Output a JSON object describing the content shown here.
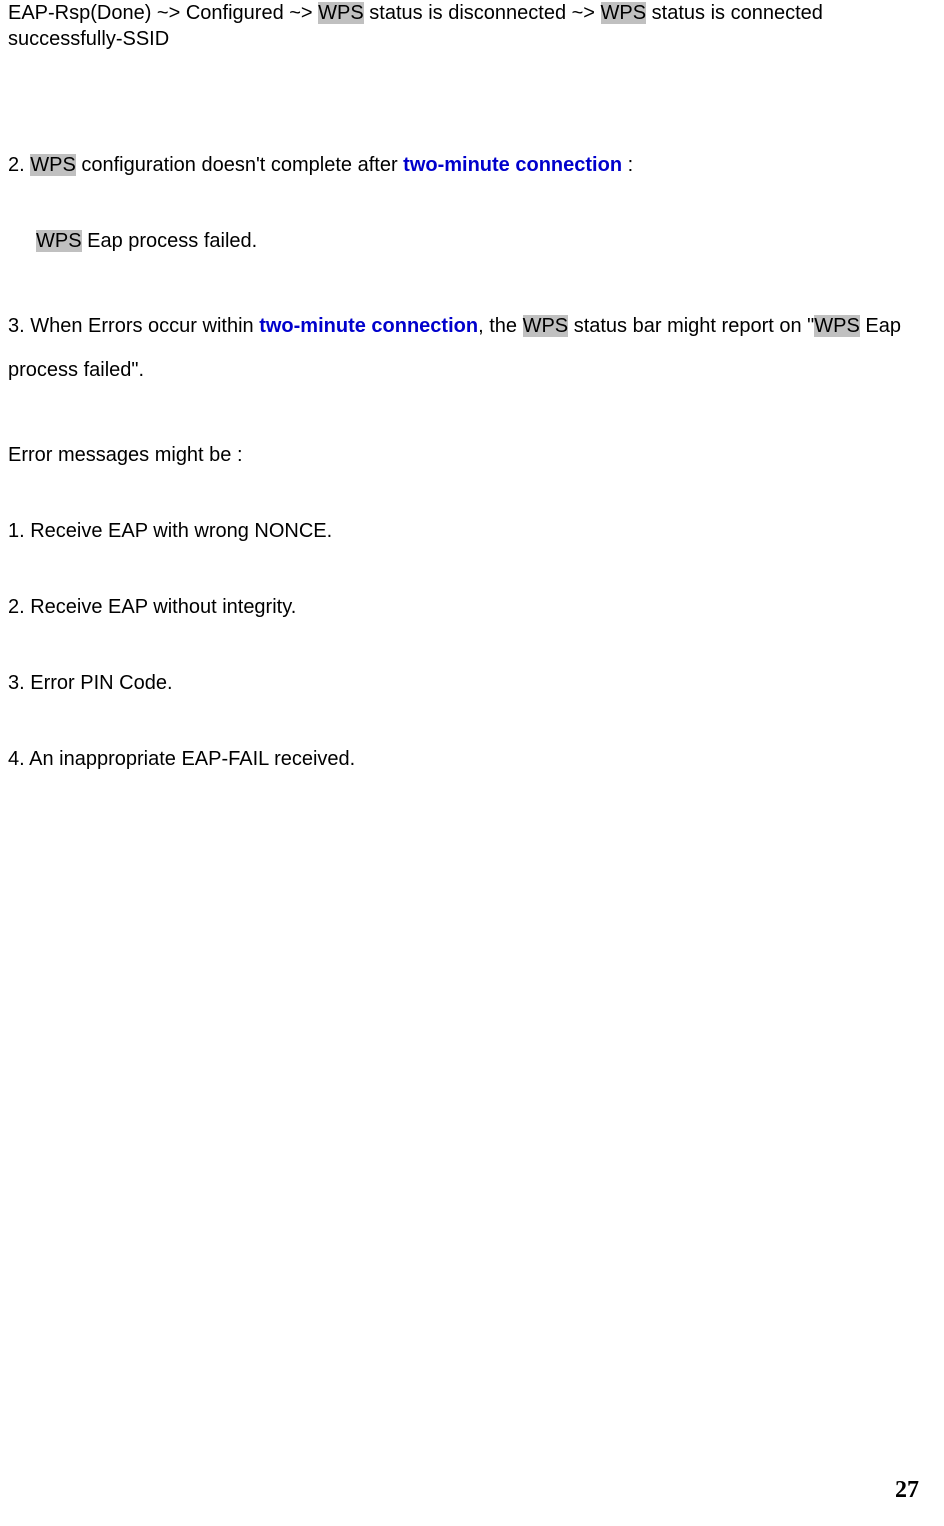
{
  "top_block": {
    "seg1": "EAP-Rsp(Done) ~> Configured ~> ",
    "wps1": "WPS",
    "seg2": " status is disconnected ~> ",
    "wps2": "WPS",
    "seg3": " status is connected successfully-SSID"
  },
  "item2": {
    "seg1": "2. ",
    "wps": "WPS",
    "seg2": " configuration doesn't complete after ",
    "bold": "two-minute connection",
    "seg3": " :"
  },
  "item2_sub": {
    "wps": "WPS",
    "seg": " Eap process failed."
  },
  "item3": {
    "seg1": "3. When Errors occur within ",
    "bold": "two-minute connection",
    "seg2": ", the ",
    "wps1": "WPS",
    "seg3": " status bar might report on \"",
    "wps2": "WPS",
    "seg4": " Eap process failed\"."
  },
  "err_intro": "Error messages might be :",
  "err1": "1. Receive EAP with wrong NONCE.",
  "err2": "2. Receive EAP without integrity.",
  "err3": "3. Error PIN Code.",
  "err4": "4. An inappropriate EAP-FAIL received.",
  "page_number": "27"
}
